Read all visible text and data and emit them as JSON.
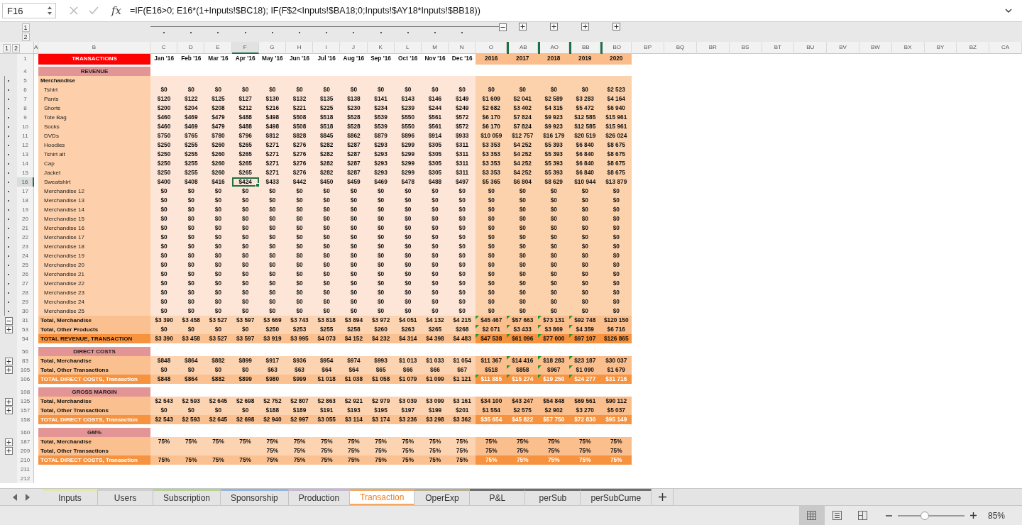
{
  "formula_bar": {
    "cell": "F16",
    "function_label": "fx",
    "formula": "=IF(E16>0; E16*(1+Inputs!$BC18);  IF(F$2<Inputs!$BA18;0;Inputs!$AY18*Inputs!$BB18))"
  },
  "column_outline": {
    "levels": [
      "1",
      "2"
    ],
    "toggles": [
      {
        "expanded": true
      },
      {
        "expanded": false
      },
      {
        "expanded": false
      },
      {
        "expanded": false
      },
      {
        "expanded": false
      }
    ]
  },
  "row_outline": {
    "levels": [
      "1",
      "2"
    ]
  },
  "columns": {
    "label_columns": [
      {
        "label": "A",
        "selected": false
      },
      {
        "label": "B",
        "selected": false
      }
    ],
    "month_columns": [
      {
        "label": "C",
        "selected": false
      },
      {
        "label": "D",
        "selected": false
      },
      {
        "label": "E",
        "selected": false
      },
      {
        "label": "F",
        "selected": true
      },
      {
        "label": "G",
        "selected": false
      },
      {
        "label": "H",
        "selected": false
      },
      {
        "label": "I",
        "selected": false
      },
      {
        "label": "J",
        "selected": false
      },
      {
        "label": "K",
        "selected": false
      },
      {
        "label": "L",
        "selected": false
      },
      {
        "label": "M",
        "selected": false
      },
      {
        "label": "N",
        "selected": false
      }
    ],
    "year_columns": [
      {
        "label": "O",
        "selected": false,
        "hidden_before": false
      },
      {
        "label": "AB",
        "selected": false,
        "hidden_before": true
      },
      {
        "label": "AO",
        "selected": false,
        "hidden_before": true
      },
      {
        "label": "BB",
        "selected": false,
        "hidden_before": true
      },
      {
        "label": "BO",
        "selected": false,
        "hidden_before": true
      }
    ],
    "extra_columns": [
      {
        "label": "BP",
        "selected": false
      },
      {
        "label": "BQ",
        "selected": false
      },
      {
        "label": "BR",
        "selected": false
      },
      {
        "label": "BS",
        "selected": false
      },
      {
        "label": "BT",
        "selected": false
      },
      {
        "label": "BU",
        "selected": false
      },
      {
        "label": "BV",
        "selected": false
      },
      {
        "label": "BW",
        "selected": false
      },
      {
        "label": "BX",
        "selected": false
      },
      {
        "label": "BY",
        "selected": false
      },
      {
        "label": "BZ",
        "selected": false
      },
      {
        "label": "CA",
        "selected": false
      }
    ]
  },
  "rows": [
    {
      "number": "1",
      "kind": "title",
      "label": "TRANSACTIONS",
      "selected": false,
      "hidden_after": true,
      "months": [
        "Jan '16",
        "Feb '16",
        "Mar '16",
        "Apr '16",
        "May '16",
        "Jun '16",
        "Jul '16",
        "Aug '16",
        "Sep '16",
        "Oct '16",
        "Nov '16",
        "Dec '16"
      ],
      "years": [
        "2016",
        "2017",
        "2018",
        "2019",
        "2020"
      ]
    },
    {
      "kind": "spacer"
    },
    {
      "number": "4",
      "kind": "section",
      "label": "REVENUE",
      "selected": false,
      "hidden_after": false
    },
    {
      "number": "5",
      "kind": "group",
      "label": "Merchandise",
      "selected": false,
      "hidden_after": false
    },
    {
      "number": "6",
      "kind": "item",
      "label": "Tshirt",
      "selected": false,
      "hidden_after": false,
      "months": [
        "$0",
        "$0",
        "$0",
        "$0",
        "$0",
        "$0",
        "$0",
        "$0",
        "$0",
        "$0",
        "$0",
        "$0"
      ],
      "years": [
        "$0",
        "$0",
        "$0",
        "$0",
        "$2 523"
      ]
    },
    {
      "number": "7",
      "kind": "item",
      "label": "Pants",
      "selected": false,
      "hidden_after": false,
      "months": [
        "$120",
        "$122",
        "$125",
        "$127",
        "$130",
        "$132",
        "$135",
        "$138",
        "$141",
        "$143",
        "$146",
        "$149"
      ],
      "years": [
        "$1 609",
        "$2 041",
        "$2 589",
        "$3 283",
        "$4 164"
      ]
    },
    {
      "number": "8",
      "kind": "item",
      "label": "Shorts",
      "selected": false,
      "hidden_after": false,
      "months": [
        "$200",
        "$204",
        "$208",
        "$212",
        "$216",
        "$221",
        "$225",
        "$230",
        "$234",
        "$239",
        "$244",
        "$249"
      ],
      "years": [
        "$2 682",
        "$3 402",
        "$4 315",
        "$5 472",
        "$6 940"
      ]
    },
    {
      "number": "9",
      "kind": "item",
      "label": "Tote Bag",
      "selected": false,
      "hidden_after": false,
      "months": [
        "$460",
        "$469",
        "$479",
        "$488",
        "$498",
        "$508",
        "$518",
        "$528",
        "$539",
        "$550",
        "$561",
        "$572"
      ],
      "years": [
        "$6 170",
        "$7 824",
        "$9 923",
        "$12 585",
        "$15 961"
      ]
    },
    {
      "number": "10",
      "kind": "item",
      "label": "Socks",
      "selected": false,
      "hidden_after": false,
      "months": [
        "$460",
        "$469",
        "$479",
        "$488",
        "$498",
        "$508",
        "$518",
        "$528",
        "$539",
        "$550",
        "$561",
        "$572"
      ],
      "years": [
        "$6 170",
        "$7 824",
        "$9 923",
        "$12 585",
        "$15 961"
      ]
    },
    {
      "number": "11",
      "kind": "item",
      "label": "DVDs",
      "selected": false,
      "hidden_after": false,
      "months": [
        "$750",
        "$765",
        "$780",
        "$796",
        "$812",
        "$828",
        "$845",
        "$862",
        "$879",
        "$896",
        "$914",
        "$933"
      ],
      "years": [
        "$10 059",
        "$12 757",
        "$16 179",
        "$20 519",
        "$26 024"
      ]
    },
    {
      "number": "12",
      "kind": "item",
      "label": "Hoodies",
      "selected": false,
      "hidden_after": false,
      "months": [
        "$250",
        "$255",
        "$260",
        "$265",
        "$271",
        "$276",
        "$282",
        "$287",
        "$293",
        "$299",
        "$305",
        "$311"
      ],
      "years": [
        "$3 353",
        "$4 252",
        "$5 393",
        "$6 840",
        "$8 675"
      ]
    },
    {
      "number": "13",
      "kind": "item",
      "label": "Tshirt alt",
      "selected": false,
      "hidden_after": false,
      "months": [
        "$250",
        "$255",
        "$260",
        "$265",
        "$271",
        "$276",
        "$282",
        "$287",
        "$293",
        "$299",
        "$305",
        "$311"
      ],
      "years": [
        "$3 353",
        "$4 252",
        "$5 393",
        "$6 840",
        "$8 675"
      ]
    },
    {
      "number": "14",
      "kind": "item",
      "label": "Cap",
      "selected": false,
      "hidden_after": false,
      "months": [
        "$250",
        "$255",
        "$260",
        "$265",
        "$271",
        "$276",
        "$282",
        "$287",
        "$293",
        "$299",
        "$305",
        "$311"
      ],
      "years": [
        "$3 353",
        "$4 252",
        "$5 393",
        "$6 840",
        "$8 675"
      ]
    },
    {
      "number": "15",
      "kind": "item",
      "label": "Jacket",
      "selected": false,
      "hidden_after": false,
      "months": [
        "$250",
        "$255",
        "$260",
        "$265",
        "$271",
        "$276",
        "$282",
        "$287",
        "$293",
        "$299",
        "$305",
        "$311"
      ],
      "years": [
        "$3 353",
        "$4 252",
        "$5 393",
        "$6 840",
        "$8 675"
      ]
    },
    {
      "number": "16",
      "kind": "item",
      "label": "Sweatshirt",
      "selected": true,
      "hidden_after": false,
      "months": [
        "$400",
        "$408",
        "$416",
        "$424",
        "$433",
        "$442",
        "$450",
        "$459",
        "$469",
        "$478",
        "$488",
        "$497"
      ],
      "years": [
        "$5 365",
        "$6 804",
        "$8 629",
        "$10 944",
        "$13 879"
      ]
    },
    {
      "number": "17",
      "kind": "item",
      "label": "Merchandise 12",
      "selected": false,
      "hidden_after": false,
      "months": [
        "$0",
        "$0",
        "$0",
        "$0",
        "$0",
        "$0",
        "$0",
        "$0",
        "$0",
        "$0",
        "$0",
        "$0"
      ],
      "years": [
        "$0",
        "$0",
        "$0",
        "$0",
        "$0"
      ]
    },
    {
      "number": "18",
      "kind": "item",
      "label": "Merchandise 13",
      "selected": false,
      "hidden_after": false,
      "months": [
        "$0",
        "$0",
        "$0",
        "$0",
        "$0",
        "$0",
        "$0",
        "$0",
        "$0",
        "$0",
        "$0",
        "$0"
      ],
      "years": [
        "$0",
        "$0",
        "$0",
        "$0",
        "$0"
      ]
    },
    {
      "number": "19",
      "kind": "item",
      "label": "Merchandise 14",
      "selected": false,
      "hidden_after": false,
      "months": [
        "$0",
        "$0",
        "$0",
        "$0",
        "$0",
        "$0",
        "$0",
        "$0",
        "$0",
        "$0",
        "$0",
        "$0"
      ],
      "years": [
        "$0",
        "$0",
        "$0",
        "$0",
        "$0"
      ]
    },
    {
      "number": "20",
      "kind": "item",
      "label": "Merchandise 15",
      "selected": false,
      "hidden_after": false,
      "months": [
        "$0",
        "$0",
        "$0",
        "$0",
        "$0",
        "$0",
        "$0",
        "$0",
        "$0",
        "$0",
        "$0",
        "$0"
      ],
      "years": [
        "$0",
        "$0",
        "$0",
        "$0",
        "$0"
      ]
    },
    {
      "number": "21",
      "kind": "item",
      "label": "Merchandise 16",
      "selected": false,
      "hidden_after": false,
      "months": [
        "$0",
        "$0",
        "$0",
        "$0",
        "$0",
        "$0",
        "$0",
        "$0",
        "$0",
        "$0",
        "$0",
        "$0"
      ],
      "years": [
        "$0",
        "$0",
        "$0",
        "$0",
        "$0"
      ]
    },
    {
      "number": "22",
      "kind": "item",
      "label": "Merchandise 17",
      "selected": false,
      "hidden_after": false,
      "months": [
        "$0",
        "$0",
        "$0",
        "$0",
        "$0",
        "$0",
        "$0",
        "$0",
        "$0",
        "$0",
        "$0",
        "$0"
      ],
      "years": [
        "$0",
        "$0",
        "$0",
        "$0",
        "$0"
      ]
    },
    {
      "number": "23",
      "kind": "item",
      "label": "Merchandise 18",
      "selected": false,
      "hidden_after": false,
      "months": [
        "$0",
        "$0",
        "$0",
        "$0",
        "$0",
        "$0",
        "$0",
        "$0",
        "$0",
        "$0",
        "$0",
        "$0"
      ],
      "years": [
        "$0",
        "$0",
        "$0",
        "$0",
        "$0"
      ]
    },
    {
      "number": "24",
      "kind": "item",
      "label": "Merchandise 19",
      "selected": false,
      "hidden_after": false,
      "months": [
        "$0",
        "$0",
        "$0",
        "$0",
        "$0",
        "$0",
        "$0",
        "$0",
        "$0",
        "$0",
        "$0",
        "$0"
      ],
      "years": [
        "$0",
        "$0",
        "$0",
        "$0",
        "$0"
      ]
    },
    {
      "number": "25",
      "kind": "item",
      "label": "Merchandise 20",
      "selected": false,
      "hidden_after": false,
      "months": [
        "$0",
        "$0",
        "$0",
        "$0",
        "$0",
        "$0",
        "$0",
        "$0",
        "$0",
        "$0",
        "$0",
        "$0"
      ],
      "years": [
        "$0",
        "$0",
        "$0",
        "$0",
        "$0"
      ]
    },
    {
      "number": "26",
      "kind": "item",
      "label": "Merchandise 21",
      "selected": false,
      "hidden_after": false,
      "months": [
        "$0",
        "$0",
        "$0",
        "$0",
        "$0",
        "$0",
        "$0",
        "$0",
        "$0",
        "$0",
        "$0",
        "$0"
      ],
      "years": [
        "$0",
        "$0",
        "$0",
        "$0",
        "$0"
      ]
    },
    {
      "number": "27",
      "kind": "item",
      "label": "Merchandise 22",
      "selected": false,
      "hidden_after": false,
      "months": [
        "$0",
        "$0",
        "$0",
        "$0",
        "$0",
        "$0",
        "$0",
        "$0",
        "$0",
        "$0",
        "$0",
        "$0"
      ],
      "years": [
        "$0",
        "$0",
        "$0",
        "$0",
        "$0"
      ]
    },
    {
      "number": "28",
      "kind": "item",
      "label": "Merchandise 23",
      "selected": false,
      "hidden_after": false,
      "months": [
        "$0",
        "$0",
        "$0",
        "$0",
        "$0",
        "$0",
        "$0",
        "$0",
        "$0",
        "$0",
        "$0",
        "$0"
      ],
      "years": [
        "$0",
        "$0",
        "$0",
        "$0",
        "$0"
      ]
    },
    {
      "number": "29",
      "kind": "item",
      "label": "Merchandise 24",
      "selected": false,
      "hidden_after": false,
      "months": [
        "$0",
        "$0",
        "$0",
        "$0",
        "$0",
        "$0",
        "$0",
        "$0",
        "$0",
        "$0",
        "$0",
        "$0"
      ],
      "years": [
        "$0",
        "$0",
        "$0",
        "$0",
        "$0"
      ]
    },
    {
      "number": "30",
      "kind": "item",
      "label": "Merchandise 25",
      "selected": false,
      "hidden_after": false,
      "months": [
        "$0",
        "$0",
        "$0",
        "$0",
        "$0",
        "$0",
        "$0",
        "$0",
        "$0",
        "$0",
        "$0",
        "$0"
      ],
      "years": [
        "$0",
        "$0",
        "$0",
        "$0",
        "$0"
      ]
    },
    {
      "number": "31",
      "kind": "total",
      "label": "Total, Merchandise",
      "selected": false,
      "hidden_after": true,
      "expanded": true,
      "months": [
        "$3 390",
        "$3 458",
        "$3 527",
        "$3 597",
        "$3 669",
        "$3 743",
        "$3 818",
        "$3 894",
        "$3 972",
        "$4 051",
        "$4 132",
        "$4 215"
      ],
      "years": [
        "$45 467",
        "$57 663",
        "$73 131",
        "$92 748",
        "$120 150"
      ],
      "year_flags": [
        true,
        true,
        true,
        true,
        false
      ]
    },
    {
      "number": "53",
      "kind": "total",
      "label": "Total, Other Products",
      "selected": false,
      "hidden_after": false,
      "expanded": false,
      "months": [
        "$0",
        "$0",
        "$0",
        "$0",
        "$250",
        "$253",
        "$255",
        "$258",
        "$260",
        "$263",
        "$265",
        "$268"
      ],
      "years": [
        "$2 071",
        "$3 433",
        "$3 869",
        "$4 359",
        "$6 716"
      ],
      "year_flags": [
        true,
        true,
        true,
        true,
        false
      ]
    },
    {
      "number": "54",
      "kind": "grand_total",
      "label": "TOTAL REVENUE, TRANSACTION",
      "inverted": false,
      "selected": false,
      "hidden_after": false,
      "months": [
        "$3 390",
        "$3 458",
        "$3 527",
        "$3 597",
        "$3 919",
        "$3 995",
        "$4 073",
        "$4 152",
        "$4 232",
        "$4 314",
        "$4 398",
        "$4 483"
      ],
      "years": [
        "$47 538",
        "$61 096",
        "$77 000",
        "$97 107",
        "$126 865"
      ],
      "year_flags": [
        true,
        true,
        true,
        true,
        false
      ]
    },
    {
      "kind": "spacer"
    },
    {
      "number": "56",
      "kind": "section",
      "label": "DIRECT COSTS",
      "selected": false,
      "hidden_after": true
    },
    {
      "number": "83",
      "kind": "total",
      "label": "Total, Merchandise",
      "selected": false,
      "hidden_after": true,
      "expanded": false,
      "months": [
        "$848",
        "$864",
        "$882",
        "$899",
        "$917",
        "$936",
        "$954",
        "$974",
        "$993",
        "$1 013",
        "$1 033",
        "$1 054"
      ],
      "years": [
        "$11 367",
        "$14 416",
        "$18 283",
        "$23 187",
        "$30 037"
      ],
      "year_flags": [
        false,
        true,
        true,
        true,
        false
      ]
    },
    {
      "number": "105",
      "kind": "total",
      "label": "Total, Other Transactions",
      "selected": false,
      "hidden_after": false,
      "expanded": false,
      "months": [
        "$0",
        "$0",
        "$0",
        "$0",
        "$63",
        "$63",
        "$64",
        "$64",
        "$65",
        "$66",
        "$66",
        "$67"
      ],
      "years": [
        "$518",
        "$858",
        "$967",
        "$1 090",
        "$1 679"
      ],
      "year_flags": [
        false,
        true,
        true,
        true,
        false
      ]
    },
    {
      "number": "106",
      "kind": "grand_total",
      "label": "TOTAL DIRECT COSTS, Transaction",
      "inverted": true,
      "selected": false,
      "hidden_after": false,
      "months": [
        "$848",
        "$864",
        "$882",
        "$899",
        "$980",
        "$999",
        "$1 018",
        "$1 038",
        "$1 058",
        "$1 079",
        "$1 099",
        "$1 121"
      ],
      "years": [
        "$11 885",
        "$15 274",
        "$19 250",
        "$24 277",
        "$31 716"
      ],
      "year_flags": [
        true,
        true,
        true,
        true,
        false
      ]
    },
    {
      "kind": "spacer"
    },
    {
      "number": "108",
      "kind": "section",
      "label": "GROSS MARGIN",
      "selected": false,
      "hidden_after": true
    },
    {
      "number": "135",
      "kind": "total",
      "label": "Total, Merchandise",
      "selected": false,
      "hidden_after": true,
      "expanded": false,
      "months": [
        "$2 543",
        "$2 593",
        "$2 645",
        "$2 698",
        "$2 752",
        "$2 807",
        "$2 863",
        "$2 921",
        "$2 979",
        "$3 039",
        "$3 099",
        "$3 161"
      ],
      "years": [
        "$34 100",
        "$43 247",
        "$54 848",
        "$69 561",
        "$90 112"
      ]
    },
    {
      "number": "157",
      "kind": "total",
      "label": "Total, Other Transactions",
      "selected": false,
      "hidden_after": false,
      "expanded": false,
      "months": [
        "$0",
        "$0",
        "$0",
        "$0",
        "$188",
        "$189",
        "$191",
        "$193",
        "$195",
        "$197",
        "$199",
        "$201"
      ],
      "years": [
        "$1 554",
        "$2 575",
        "$2 902",
        "$3 270",
        "$5 037"
      ]
    },
    {
      "number": "158",
      "kind": "grand_total",
      "label": "TOTAL DIRECT COSTS, Transaction",
      "inverted": true,
      "selected": false,
      "hidden_after": false,
      "months": [
        "$2 543",
        "$2 593",
        "$2 645",
        "$2 698",
        "$2 940",
        "$2 997",
        "$3 055",
        "$3 114",
        "$3 174",
        "$3 236",
        "$3 298",
        "$3 362"
      ],
      "years": [
        "$35 654",
        "$45 822",
        "$57 750",
        "$72 830",
        "$95 149"
      ]
    },
    {
      "kind": "spacer"
    },
    {
      "number": "160",
      "kind": "section",
      "label": "GM%",
      "selected": false,
      "hidden_after": true
    },
    {
      "number": "187",
      "kind": "total",
      "label": "Total, Merchandise",
      "selected": false,
      "hidden_after": true,
      "expanded": false,
      "months": [
        "75%",
        "75%",
        "75%",
        "75%",
        "75%",
        "75%",
        "75%",
        "75%",
        "75%",
        "75%",
        "75%",
        "75%"
      ],
      "years": [
        "75%",
        "75%",
        "75%",
        "75%",
        "75%"
      ]
    },
    {
      "number": "209",
      "kind": "total",
      "label": "Total, Other Transactions",
      "selected": false,
      "hidden_after": false,
      "expanded": false,
      "blank_months": [
        true,
        true,
        true,
        true,
        false,
        false,
        false,
        false,
        false,
        false,
        false,
        false
      ],
      "months": [
        "75%",
        "75%",
        "75%",
        "75%",
        "75%",
        "75%",
        "75%",
        "75%"
      ],
      "years": [
        "75%",
        "75%",
        "75%",
        "75%",
        "75%"
      ]
    },
    {
      "number": "210",
      "kind": "grand_total",
      "label": "TOTAL DIRECT COSTS, Transaction",
      "inverted": true,
      "selected": false,
      "hidden_after": false,
      "months": [
        "75%",
        "75%",
        "75%",
        "75%",
        "75%",
        "75%",
        "75%",
        "75%",
        "75%",
        "75%",
        "75%",
        "75%"
      ],
      "years": [
        "75%",
        "75%",
        "75%",
        "75%",
        "75%"
      ]
    },
    {
      "number": "211",
      "kind": "blank",
      "selected": false,
      "hidden_after": false
    },
    {
      "number": "212",
      "kind": "blank",
      "selected": false,
      "hidden_after": false
    }
  ],
  "sheet_tabs": [
    {
      "label": "Inputs",
      "selected": false,
      "color": "#e3e8a4"
    },
    {
      "label": "Users",
      "selected": false,
      "color": "#cfcfcf"
    },
    {
      "label": "Subscription",
      "selected": false,
      "color": "#b7d48f"
    },
    {
      "label": "Sponsorship",
      "selected": false,
      "color": "#93b6e0"
    },
    {
      "label": "Production",
      "selected": false,
      "color": "#c8b5d8"
    },
    {
      "label": "Transaction",
      "selected": true,
      "color": "#f5a860"
    },
    {
      "label": "OperExp",
      "selected": false,
      "color": "#b5ad8c"
    },
    {
      "label": "P&L",
      "selected": false,
      "color": "#6e6e6e"
    },
    {
      "label": "perSub",
      "selected": false,
      "color": "#6e6e6e"
    },
    {
      "label": "perSubCume",
      "selected": false,
      "color": "#6e6e6e"
    }
  ],
  "status_bar": {
    "views": [
      {
        "selected": true
      },
      {
        "selected": false
      },
      {
        "selected": false
      }
    ],
    "zoom": {
      "level": 0.4,
      "reading": "85%"
    }
  }
}
